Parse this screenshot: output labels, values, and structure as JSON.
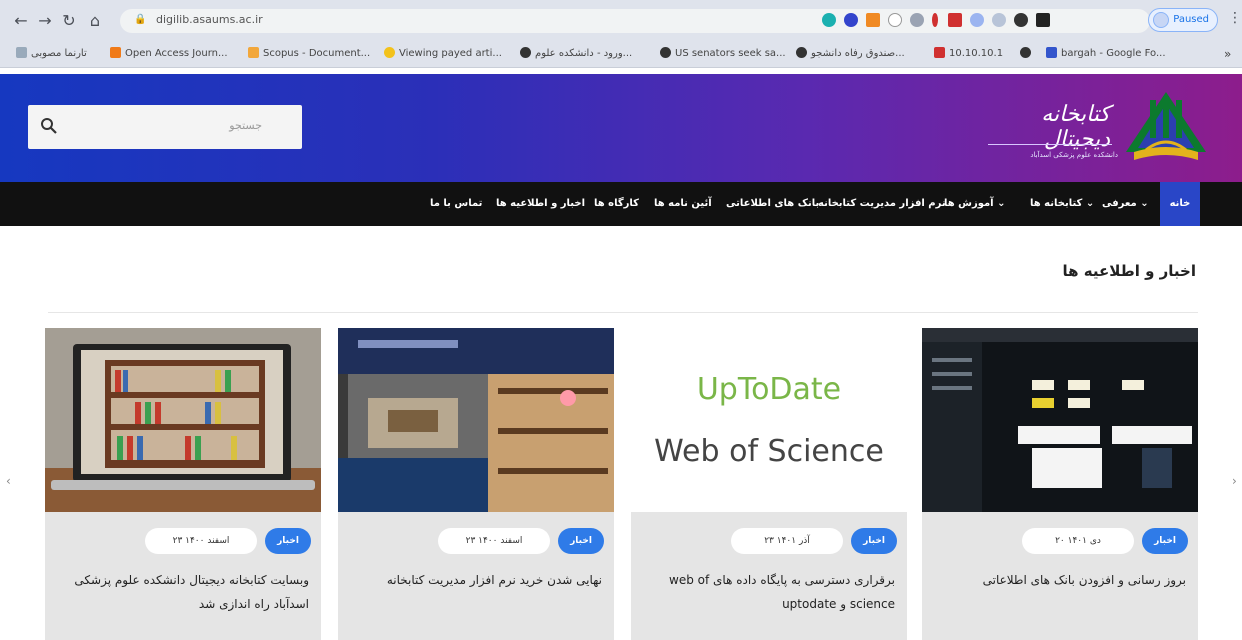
{
  "browser": {
    "url": "digilib.asaums.ac.ir",
    "profile_label": "Paused",
    "bookmarks": [
      "تارنما مصوبی",
      "Open Access Journ...",
      "Scopus - Document...",
      "Viewing payed arti...",
      "ورود - دانشکده علوم...",
      "US senators seek sa...",
      "صندوق رفاه دانشجو...",
      "10.10.10.1",
      "bargah - Google Fo..."
    ]
  },
  "header": {
    "search_placeholder": "جستجو",
    "logo_text": "کتابخانه دیجیتال",
    "logo_subtitle": "دانشکده علوم پزشکی اسدآباد"
  },
  "nav": {
    "home": "خانه",
    "items": [
      "معرفی",
      "کتابخانه ها",
      "آموزش ها",
      "نرم افزار مدیریت کتابخانه",
      "بانک های اطلاعاتی",
      "آئین نامه ها",
      "کارگاه ها",
      "اخبار و اطلاعیه ها",
      "تماس با ما"
    ]
  },
  "news": {
    "section_title": "اخبار و اطلاعیه ها",
    "cards": [
      {
        "badge": "اخبار",
        "date": "۲۰ دی ۱۴۰۱",
        "title": "بروز رسانی و افزودن بانک های اطلاعاتی"
      },
      {
        "badge": "اخبار",
        "date": "۲۳ آذر ۱۴۰۱",
        "title": "برقراری دسترسی به پایگاه داده های web of science و uptodate",
        "image_text_1": "UpToDate",
        "image_text_2": "Web of Science"
      },
      {
        "badge": "اخبار",
        "date": "۲۳ اسفند ۱۴۰۰",
        "title": "نهایی شدن خرید نرم افزار مدیریت کتابخانه"
      },
      {
        "badge": "اخبار",
        "date": "۲۳ اسفند ۱۴۰۰",
        "title": "وبسایت کتابخانه دیجیتال دانشکده علوم پزشکی اسدآباد راه اندازی شد"
      }
    ]
  },
  "colors": {
    "header_gradient_start": "#1638c0",
    "header_gradient_end": "#8d1d8c",
    "nav_bg": "#111111",
    "nav_active": "#2946c7",
    "badge": "#2f7be8",
    "uptodate_green": "#7ab648"
  }
}
